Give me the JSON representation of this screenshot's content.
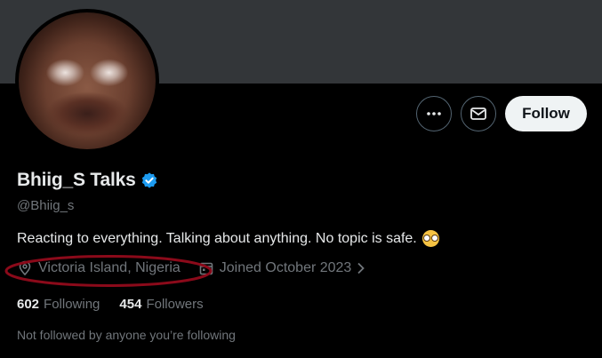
{
  "profile": {
    "display_name": "Bhiig_S Talks",
    "handle": "@Bhiig_s",
    "bio": "Reacting to everything. Talking about anything. No topic is safe.",
    "bio_emoji": "nerd-face-emoji",
    "location": "Victoria Island, Nigeria",
    "joined": "Joined October 2023",
    "following_count": "602",
    "following_label": "Following",
    "followers_count": "454",
    "followers_label": "Followers",
    "followed_by_text": "Not followed by anyone you’re following"
  },
  "actions": {
    "follow_label": "Follow",
    "more_icon": "more-icon",
    "message_icon": "mail-icon"
  },
  "colors": {
    "background": "#000000",
    "banner": "#333639",
    "verified_badge": "#1d9bf0",
    "secondary_text": "#71767b",
    "highlight_annotation": "#8b0a1a"
  }
}
